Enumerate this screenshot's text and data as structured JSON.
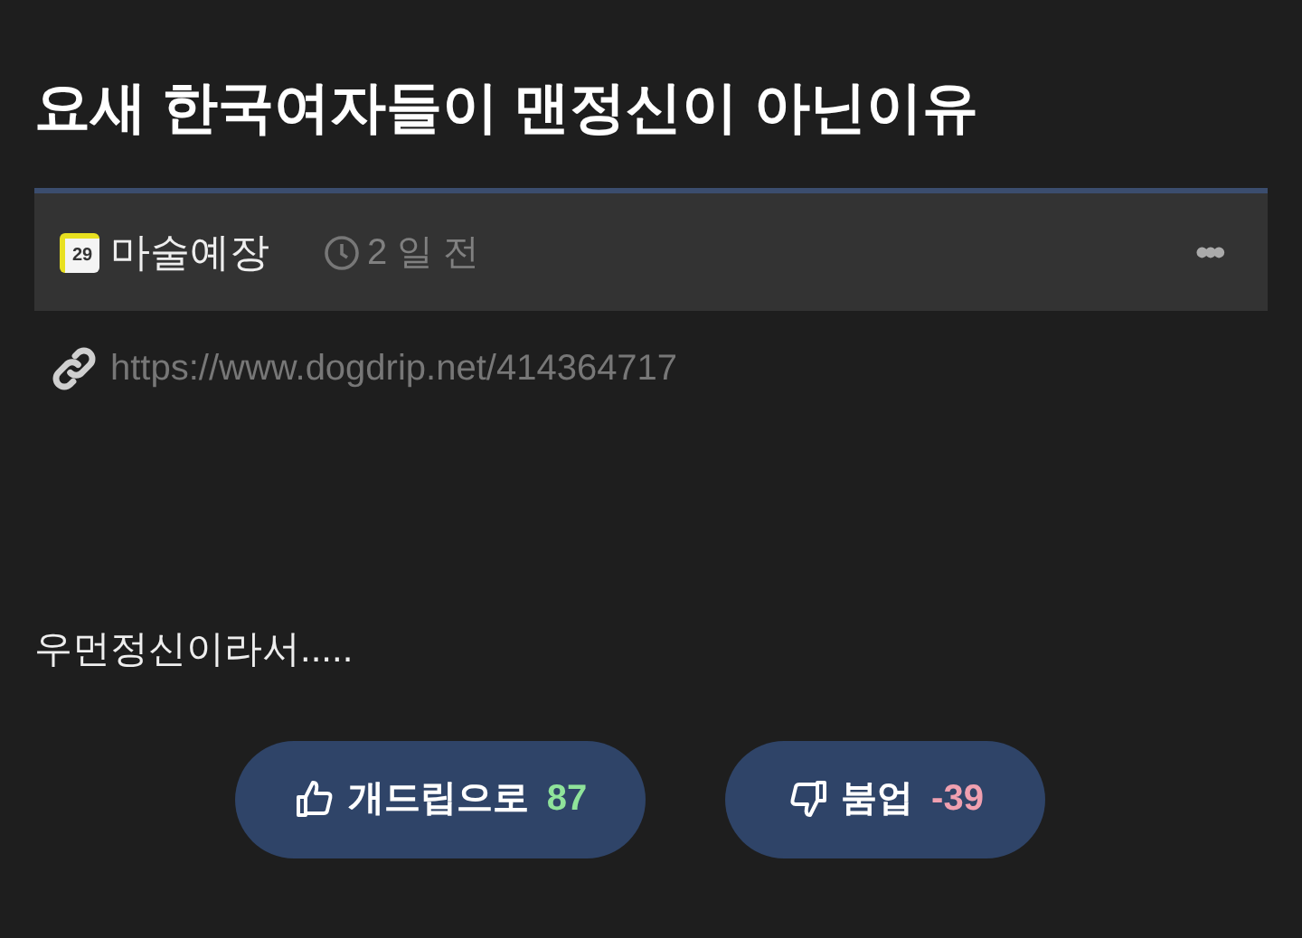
{
  "title": "요새 한국여자들이 맨정신이 아닌이유",
  "author": {
    "badge": "29",
    "name": "마술예장"
  },
  "time": "2 일 전",
  "more": "•••",
  "link": "https://www.dogdrip.net/414364717",
  "body": "우먼정신이라서.....",
  "votes": [
    {
      "kind": "up",
      "label": "개드립으로",
      "count": "87"
    },
    {
      "kind": "down",
      "label": "붐업",
      "count": "-39"
    }
  ]
}
